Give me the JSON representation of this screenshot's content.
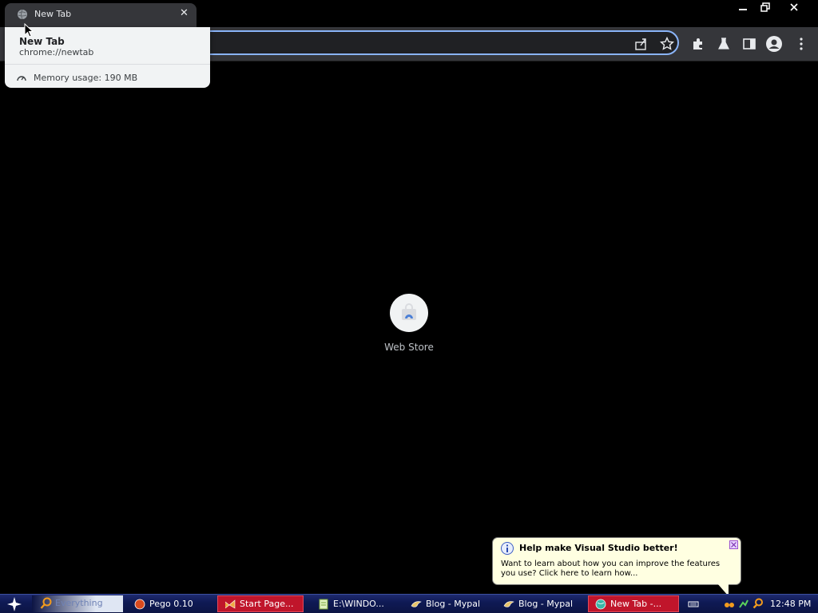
{
  "browser": {
    "tab": {
      "title": "New Tab"
    },
    "hovercard": {
      "title": "New Tab",
      "url": "chrome://newtab",
      "memory": "Memory usage: 190 MB"
    }
  },
  "newtab": {
    "shortcut_label": "Web Store"
  },
  "balloon": {
    "title": "Help make Visual Studio better!",
    "text": "Want to learn about how you can improve the features you use? Click here to learn how..."
  },
  "taskbar": {
    "search_placeholder": "Everything",
    "tasks": [
      {
        "label": "Pego 0.10"
      },
      {
        "label": "Start Page..."
      },
      {
        "label": "E:\\WINDO..."
      },
      {
        "label": "Blog - Mypal"
      },
      {
        "label": "Blog - Mypal"
      },
      {
        "label": "New Tab -..."
      }
    ],
    "clock": "12:48 PM"
  },
  "colors": {
    "accent": "#8ab4f8",
    "taskbar": "#0f1a55",
    "active_task": "#c0152b"
  }
}
